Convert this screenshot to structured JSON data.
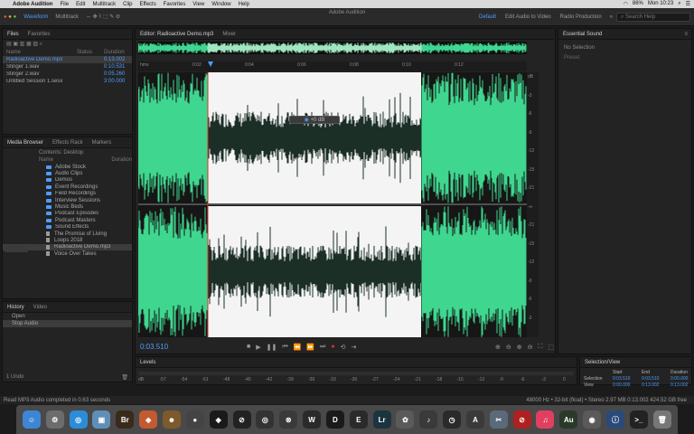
{
  "menubar": {
    "app": "Adobe Audition",
    "items": [
      "File",
      "Edit",
      "Multitrack",
      "Clip",
      "Effects",
      "Favorites",
      "View",
      "Window",
      "Help"
    ],
    "battery": "86%",
    "clock": "Mon 10:23"
  },
  "window_title": "Adobe Audition",
  "toolbar": {
    "waveform_label": "Waveform",
    "multitrack_label": "Multitrack",
    "workspaces": [
      "Default",
      "Edit Audio to Video",
      "Radio Production"
    ],
    "search_placeholder": "Search Help"
  },
  "files": {
    "tabs": [
      "Files",
      "Favorites"
    ],
    "columns": [
      "Name",
      "Status",
      "Duration"
    ],
    "rows": [
      {
        "name": "Radioactive Demo.mp3",
        "status": "",
        "duration": "0:13.002",
        "selected": true
      },
      {
        "name": "Stinger 1.wav",
        "status": "",
        "duration": "0:10.531",
        "selected": false
      },
      {
        "name": "Stinger 2.wav",
        "status": "",
        "duration": "0:05.260",
        "selected": false
      },
      {
        "name": "Untitled Session 1.sesx",
        "status": "",
        "duration": "3:00.000",
        "selected": false
      }
    ]
  },
  "media": {
    "tabs": [
      "Media Browser",
      "Effects Rack",
      "Markers"
    ],
    "contents_label": "Contents:",
    "contents_value": "Desktop",
    "name_col": "Name",
    "dur_col": "Duration",
    "rows": [
      {
        "name": "Adobe Stock",
        "type": "folder",
        "selected": false
      },
      {
        "name": "Audio Clips",
        "type": "folder",
        "selected": false
      },
      {
        "name": "Demos",
        "type": "folder",
        "selected": false
      },
      {
        "name": "Event Recordings",
        "type": "folder",
        "selected": false
      },
      {
        "name": "Field Recordings",
        "type": "folder",
        "selected": false
      },
      {
        "name": "Interview Sessions",
        "type": "folder",
        "selected": false
      },
      {
        "name": "Music Beds",
        "type": "folder",
        "selected": false
      },
      {
        "name": "Podcast Episodes",
        "type": "folder",
        "selected": false
      },
      {
        "name": "Podcast Masters",
        "type": "folder",
        "selected": false
      },
      {
        "name": "Sound Effects",
        "type": "folder",
        "selected": false
      },
      {
        "name": "The Promise of Living",
        "type": "file",
        "selected": false
      },
      {
        "name": "Loops 2018",
        "type": "file",
        "selected": false
      },
      {
        "name": "Radioactive Demo.mp3",
        "type": "file",
        "selected": true
      },
      {
        "name": "Voice Over Takes",
        "type": "file",
        "selected": false
      }
    ]
  },
  "history": {
    "tabs": [
      "History",
      "Video"
    ],
    "rows": [
      {
        "label": "Open",
        "selected": false
      },
      {
        "label": "Stop Audio",
        "selected": true
      }
    ],
    "undo_count": "1 Undo"
  },
  "editor": {
    "tabs": [
      "Editor: Radioactive Demo.mp3",
      "Mixer"
    ],
    "ruler_ticks": [
      "hms",
      "0:02",
      "0:04",
      "0:06",
      "0:08",
      "0:10",
      "0:12"
    ],
    "db_ticks": [
      "dB",
      "-3",
      "-6",
      "-9",
      "-12",
      "-15",
      "-21",
      "-∞",
      "-21",
      "-15",
      "-12",
      "-9",
      "-6",
      "-3"
    ],
    "hud_value": "+0 dB",
    "timecode": "0:03.510"
  },
  "essential": {
    "title": "Essential Sound",
    "subtitle": "No Selection",
    "line2": "Preset"
  },
  "levels": {
    "title": "Levels",
    "ticks": [
      "dB",
      "-57",
      "-54",
      "-51",
      "-48",
      "-45",
      "-42",
      "-39",
      "-36",
      "-33",
      "-30",
      "-27",
      "-24",
      "-21",
      "-18",
      "-15",
      "-12",
      "-9",
      "-6",
      "-3",
      "0"
    ]
  },
  "selview": {
    "title": "Selection/View",
    "headers": [
      "",
      "Start",
      "End",
      "Duration"
    ],
    "rows": [
      [
        "Selection",
        "0:03.510",
        "0:03.510",
        "0:00.000"
      ],
      [
        "View",
        "0:00.000",
        "0:13.002",
        "0:13.002"
      ]
    ]
  },
  "status": {
    "left": "Read MP3 Audio completed in 0.63 seconds",
    "right": "48000 Hz • 32-bit (float) • Stereo     2.97 MB     0:13.002     424.52 GB free"
  },
  "dock": {
    "items": [
      {
        "name": "finder",
        "glyph": "☺",
        "color": "#3d86d6"
      },
      {
        "name": "launchpad",
        "glyph": "⚙",
        "color": "#6c6c6c"
      },
      {
        "name": "safari",
        "glyph": "◎",
        "color": "#2b8cd9"
      },
      {
        "name": "preview",
        "glyph": "▣",
        "color": "#5f8fb8"
      },
      {
        "name": "bridge",
        "glyph": "Br",
        "color": "#3a2a1a"
      },
      {
        "name": "maps",
        "glyph": "◆",
        "color": "#c45a2f"
      },
      {
        "name": "character",
        "glyph": "☻",
        "color": "#7d5a2b"
      },
      {
        "name": "camera",
        "glyph": "●",
        "color": "#444"
      },
      {
        "name": "daw",
        "glyph": "◈",
        "color": "#1a1a1a"
      },
      {
        "name": "steam",
        "glyph": "⊘",
        "color": "#222"
      },
      {
        "name": "unity",
        "glyph": "◎",
        "color": "#333"
      },
      {
        "name": "chrome",
        "glyph": "⊗",
        "color": "#3a3a3a"
      },
      {
        "name": "wordpress",
        "glyph": "W",
        "color": "#2a2a2a"
      },
      {
        "name": "lightroom-d",
        "glyph": "D",
        "color": "#1a1a1a"
      },
      {
        "name": "editor",
        "glyph": "E",
        "color": "#2a2a2a"
      },
      {
        "name": "lightroom",
        "glyph": "Lr",
        "color": "#1c3340"
      },
      {
        "name": "photos",
        "glyph": "✿",
        "color": "#5a5a5a"
      },
      {
        "name": "piano",
        "glyph": "♪",
        "color": "#3a3a3a"
      },
      {
        "name": "clock",
        "glyph": "◷",
        "color": "#2a2a2a"
      },
      {
        "name": "appstore",
        "glyph": "A",
        "color": "#3a3a3a"
      },
      {
        "name": "tools",
        "glyph": "✂",
        "color": "#5a6a7a"
      },
      {
        "name": "noentry",
        "glyph": "⊘",
        "color": "#b02020"
      },
      {
        "name": "music",
        "glyph": "♫",
        "color": "#e04060"
      },
      {
        "name": "audition",
        "glyph": "Au",
        "color": "#2a3a2a"
      },
      {
        "name": "colorsync",
        "glyph": "◉",
        "color": "#5a5a5a"
      },
      {
        "name": "info",
        "glyph": "ⓘ",
        "color": "#2a4a7a"
      },
      {
        "name": "terminal",
        "glyph": ">_",
        "color": "#222"
      },
      {
        "name": "trash",
        "glyph": "🗑",
        "color": "#777"
      }
    ]
  },
  "colors": {
    "accent": "#4e9cff",
    "wave": "#3fd68f",
    "wave_selected": "#1c2f27",
    "record": "#e03232"
  }
}
